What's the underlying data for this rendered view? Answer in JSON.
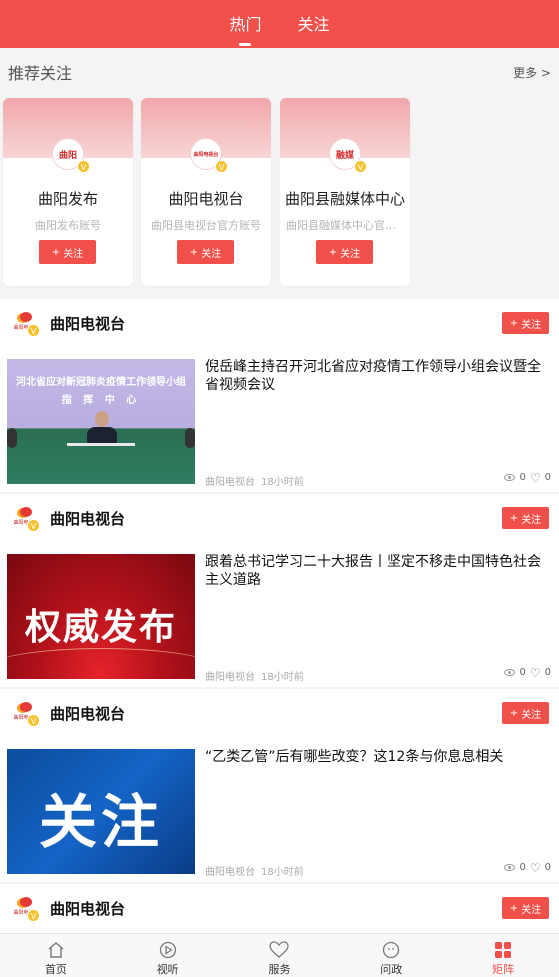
{
  "topbar": {
    "tabs": [
      "热门",
      "关注"
    ]
  },
  "recommend": {
    "title": "推荐关注",
    "more": "更多 >",
    "cards": [
      {
        "name": "曲阳发布",
        "desc": "曲阳发布账号",
        "follow": "关注",
        "logo_text": "曲阳"
      },
      {
        "name": "曲阳电视台",
        "desc": "曲阳县电视台官方账号",
        "follow": "关注",
        "logo_text": "曲阳电视台"
      },
      {
        "name": "曲阳县融媒体中心",
        "desc": "曲阳县融媒体中心官方...",
        "follow": "关注",
        "logo_text": "融媒"
      }
    ]
  },
  "feed": [
    {
      "channel": "曲阳电视台",
      "follow": "关注",
      "title": "倪岳峰主持召开河北省应对疫情工作领导小组会议暨全省视频会议",
      "image_text": [
        "河北省应对新冠肺炎疫情工作领导小组",
        "指 挥 中 心"
      ],
      "source": "曲阳电视台",
      "time": "18小时前",
      "views": "0",
      "likes": "0"
    },
    {
      "channel": "曲阳电视台",
      "follow": "关注",
      "title": "跟着总书记学习二十大报告丨坚定不移走中国特色社会主义道路",
      "image_text": [
        "权威发布"
      ],
      "source": "曲阳电视台",
      "time": "18小时前",
      "views": "0",
      "likes": "0"
    },
    {
      "channel": "曲阳电视台",
      "follow": "关注",
      "title": "“乙类乙管”后有哪些改变？这12条与你息息相关",
      "image_text": [
        "关注"
      ],
      "source": "曲阳电视台",
      "time": "18小时前",
      "views": "0",
      "likes": "0"
    },
    {
      "channel": "曲阳电视台",
      "follow": "关注"
    }
  ],
  "nav": {
    "items": [
      {
        "label": "首页",
        "icon": "home-icon"
      },
      {
        "label": "视听",
        "icon": "play-icon"
      },
      {
        "label": "服务",
        "icon": "heart-icon"
      },
      {
        "label": "问政",
        "icon": "chat-icon"
      },
      {
        "label": "矩阵",
        "icon": "grid-icon",
        "active": true
      }
    ]
  },
  "colors": {
    "accent": "#f1504a",
    "vbadge": "#f5c12c"
  }
}
